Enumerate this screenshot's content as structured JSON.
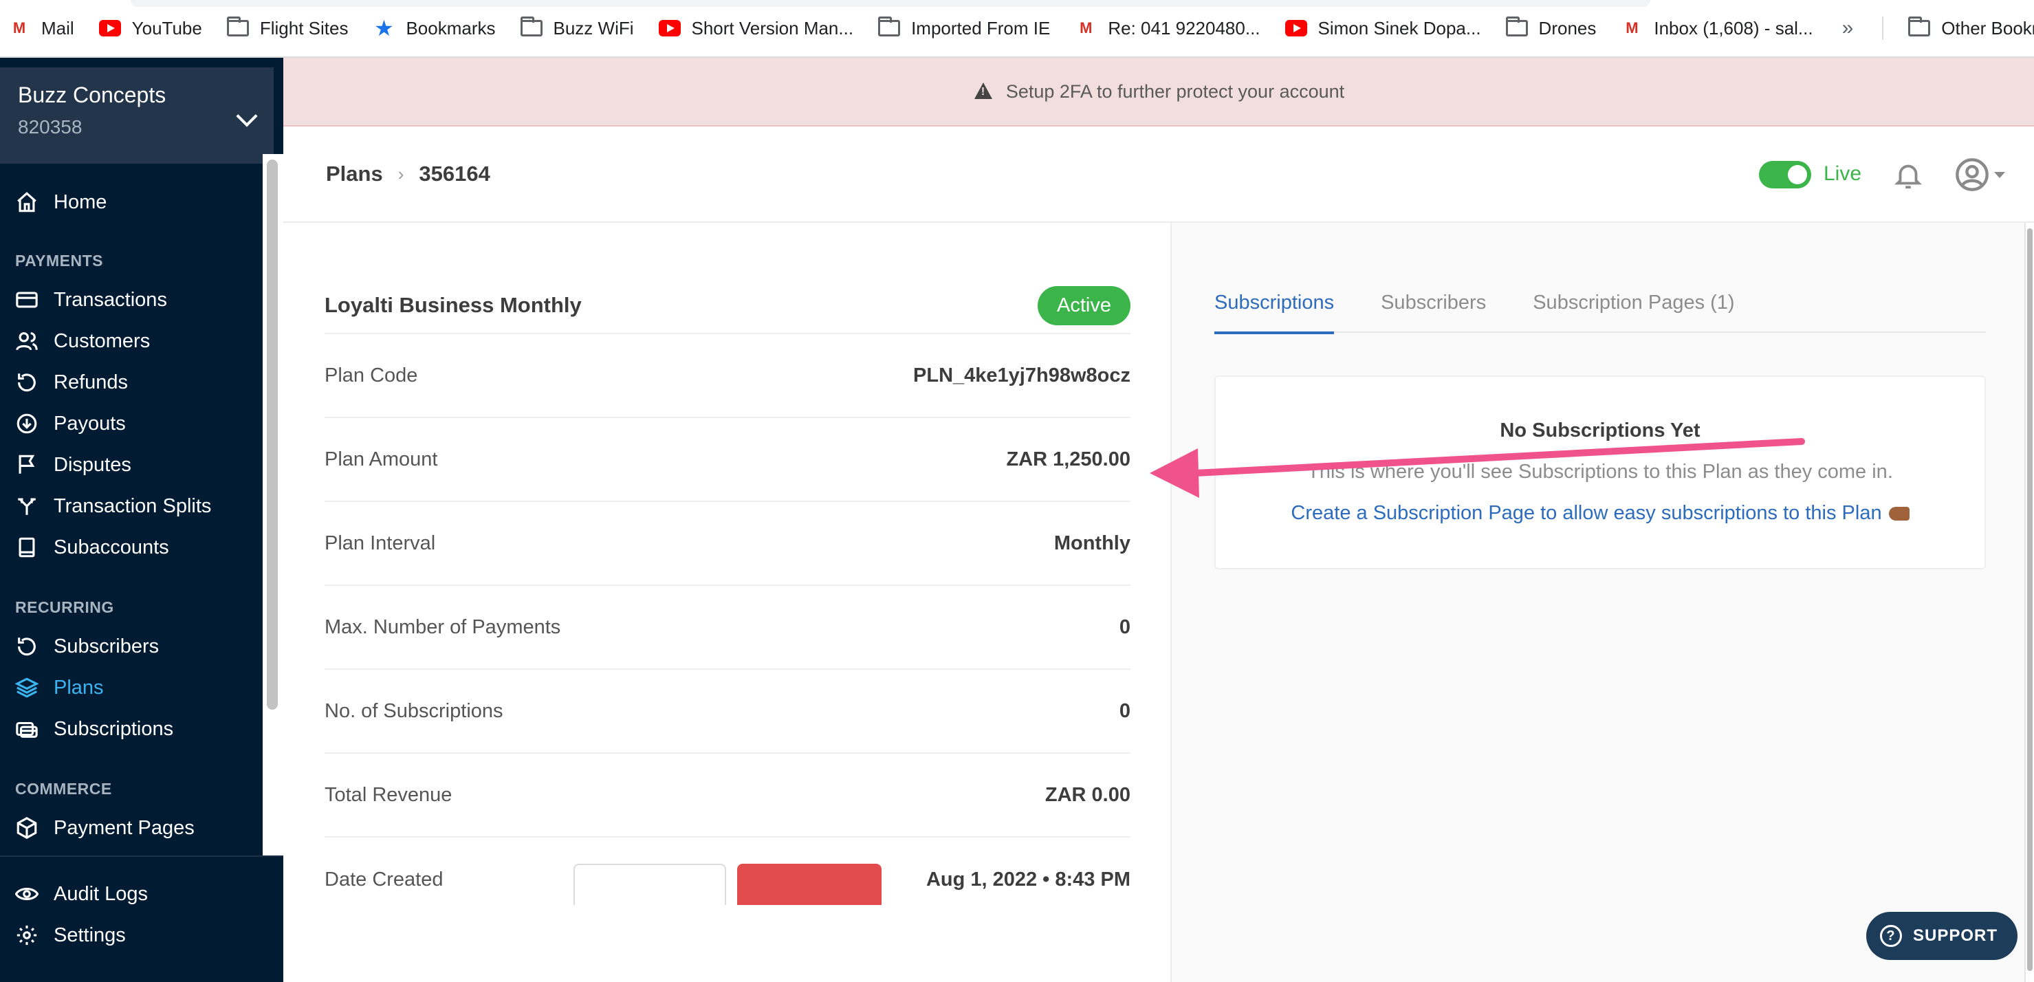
{
  "bookmarks": {
    "items": [
      {
        "label": "Mail",
        "icon": "gmail-icon"
      },
      {
        "label": "YouTube",
        "icon": "youtube-icon"
      },
      {
        "label": "Flight Sites",
        "icon": "folder-icon"
      },
      {
        "label": "Bookmarks",
        "icon": "star-icon"
      },
      {
        "label": "Buzz WiFi",
        "icon": "folder-icon"
      },
      {
        "label": "Short Version Man...",
        "icon": "youtube-icon"
      },
      {
        "label": "Imported From IE",
        "icon": "folder-icon"
      },
      {
        "label": "Re: 041 9220480...",
        "icon": "gmail-icon"
      },
      {
        "label": "Simon Sinek Dopa...",
        "icon": "youtube-icon"
      },
      {
        "label": "Drones",
        "icon": "folder-icon"
      },
      {
        "label": "Inbox (1,608) - sal...",
        "icon": "gmail-icon"
      }
    ],
    "overflow": "»",
    "other": "Other Bookmar"
  },
  "business": {
    "name": "Buzz Concepts",
    "id": "820358"
  },
  "sidebar": {
    "home": "Home",
    "sections": {
      "payments": "PAYMENTS",
      "recurring": "RECURRING",
      "commerce": "COMMERCE"
    },
    "payments": [
      "Transactions",
      "Customers",
      "Refunds",
      "Payouts",
      "Disputes",
      "Transaction Splits",
      "Subaccounts"
    ],
    "recurring": [
      "Subscribers",
      "Plans",
      "Subscriptions"
    ],
    "commerce": [
      "Payment Pages"
    ],
    "bottom": [
      "Audit Logs",
      "Settings"
    ],
    "active": "Plans"
  },
  "banner": {
    "text": "Setup 2FA to further protect your account"
  },
  "breadcrumb": {
    "root": "Plans",
    "separator": "›",
    "current": "356164"
  },
  "header": {
    "mode_label": "Live"
  },
  "plan": {
    "name": "Loyalti Business Monthly",
    "status": "Active",
    "rows": [
      {
        "label": "Plan Code",
        "value": "PLN_4ke1yj7h98w8ocz"
      },
      {
        "label": "Plan Amount",
        "value": "ZAR 1,250.00"
      },
      {
        "label": "Plan Interval",
        "value": "Monthly"
      },
      {
        "label": "Max. Number of Payments",
        "value": "0"
      },
      {
        "label": "No. of Subscriptions",
        "value": "0"
      },
      {
        "label": "Total Revenue",
        "value": "ZAR 0.00"
      },
      {
        "label": "Date Created",
        "value": "Aug 1, 2022 • 8:43 PM"
      }
    ]
  },
  "tabs": [
    "Subscriptions",
    "Subscribers",
    "Subscription Pages (1)"
  ],
  "empty_state": {
    "title": "No Subscriptions Yet",
    "description": "This is where you'll see Subscriptions to this Plan as they come in.",
    "link": "Create a Subscription Page to allow easy subscriptions to this Plan"
  },
  "support": {
    "label": "SUPPORT"
  },
  "colors": {
    "sidebar": "#011b33",
    "accent": "#3bb4f2",
    "live": "#3bb54a",
    "link": "#2d6bbd",
    "annotation_arrow": "#f0538a"
  }
}
